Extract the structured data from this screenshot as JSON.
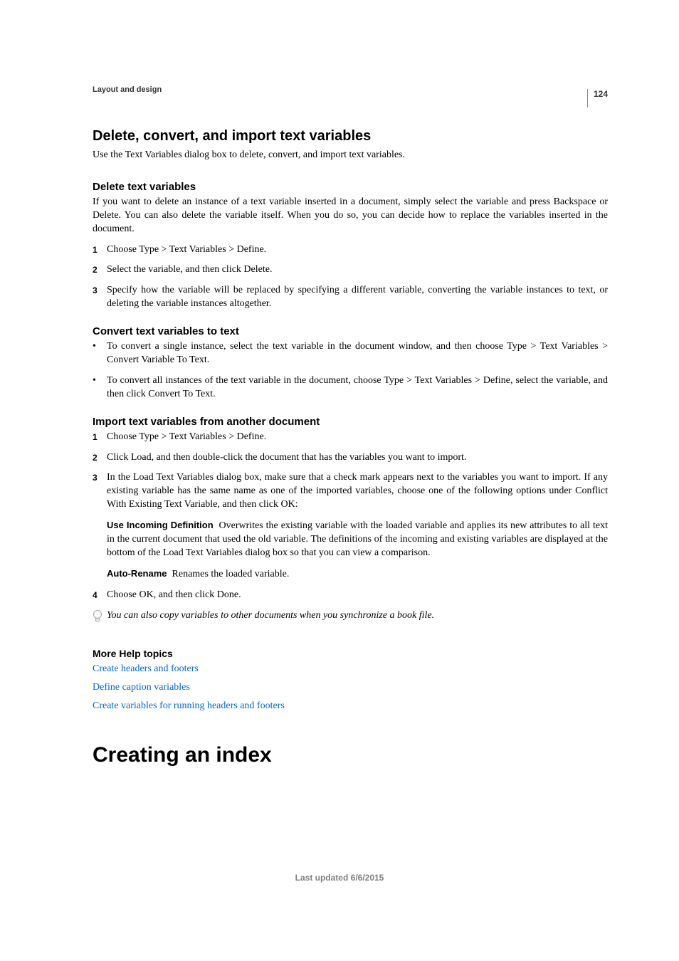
{
  "page_number": "124",
  "running_header": "Layout and design",
  "section": {
    "title": "Delete, convert, and import text variables",
    "intro": "Use the Text Variables dialog box to delete, convert, and import text variables."
  },
  "delete": {
    "heading": "Delete text variables",
    "body": "If you want to delete an instance of a text variable inserted in a document, simply select the variable and press Backspace or Delete. You can also delete the variable itself. When you do so, you can decide how to replace the variables inserted in the document.",
    "steps": [
      "Choose Type > Text Variables > Define.",
      "Select the variable, and then click Delete.",
      "Specify how the variable will be replaced by specifying a different variable, converting the variable instances to text, or deleting the variable instances altogether."
    ]
  },
  "convert": {
    "heading": "Convert text variables to text",
    "bullets": [
      "To convert a single instance, select the text variable in the document window, and then choose Type > Text Variables > Convert Variable To Text.",
      "To convert all instances of the text variable in the document, choose Type > Text Variables > Define, select the variable, and then click Convert To Text."
    ]
  },
  "import": {
    "heading": "Import text variables from another document",
    "steps": [
      "Choose Type > Text Variables > Define.",
      "Click Load, and then double-click the document that has the variables you want to import.",
      "In the Load Text Variables dialog box, make sure that a check mark appears next to the variables you want to import. If any existing variable has the same name as one of the imported variables, choose one of the following options under Conflict With Existing Text Variable, and then click OK:"
    ],
    "defs": [
      {
        "label": "Use Incoming Definition",
        "text": "Overwrites the existing variable with the loaded variable and applies its new attributes to all text in the current document that used the old variable. The definitions of the incoming and existing variables are displayed at the bottom of the Load Text Variables dialog box so that you can view a comparison."
      },
      {
        "label": "Auto-Rename",
        "text": "Renames the loaded variable."
      }
    ],
    "step4": "Choose OK, and then click Done.",
    "tip": "You can also copy variables to other documents when you synchronize a book file."
  },
  "more_help": {
    "heading": "More Help topics",
    "links": [
      "Create headers and footers",
      "Define caption variables",
      "Create variables for running headers and footers"
    ]
  },
  "chapter_title": "Creating an index",
  "footer": "Last updated 6/6/2015"
}
